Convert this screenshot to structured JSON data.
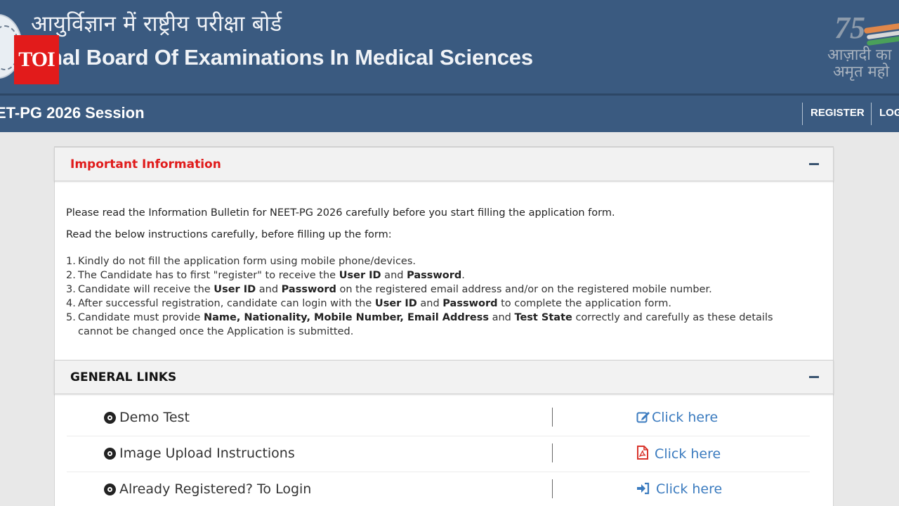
{
  "header": {
    "hindi_title": "आयुर्विज्ञान में राष्ट्रीय परीक्षा बोर्ड",
    "english_title": "ional Board Of Examinations In Medical Sciences",
    "toi_badge": "TOI",
    "azadi_logo": {
      "number": "75",
      "line1": "आज़ादी का",
      "line2": "अमृत महो"
    }
  },
  "navbar": {
    "session_title": "ET-PG 2026 Session",
    "links": [
      "REGISTER",
      "LOG"
    ]
  },
  "important_info": {
    "title": "Important Information",
    "title_color": "#e01b1b",
    "intro": "Please read the Information Bulletin for NEET-PG 2026 carefully before you start filling the application form.",
    "subheading": "Read the below instructions carefully, before filling up the form:",
    "instructions": [
      {
        "num": "1.",
        "parts": [
          "Kindly do not fill the application form using mobile phone/devices."
        ]
      },
      {
        "num": "2.",
        "parts": [
          "The Candidate has to first \"register\" to receive the ",
          "User ID",
          " and ",
          "Password",
          "."
        ]
      },
      {
        "num": "3.",
        "parts": [
          "Candidate will receive the ",
          "User ID",
          " and ",
          "Password",
          " on the registered email address and/or on the registered mobile number."
        ]
      },
      {
        "num": "4.",
        "parts": [
          "After successful registration, candidate can login with the ",
          "User ID",
          " and ",
          "Password",
          " to complete the application form."
        ]
      },
      {
        "num": "5.",
        "parts": [
          "Candidate must provide ",
          "Name, Nationality, Mobile Number, Email Address",
          " and ",
          "Test State",
          " correctly and carefully as these details cannot be changed once the Application is submitted."
        ]
      }
    ]
  },
  "general_links": {
    "title": "GENERAL LINKS",
    "rows": [
      {
        "label": "Demo Test",
        "action": "Click here",
        "icon": "edit-icon"
      },
      {
        "label": "Image Upload Instructions",
        "action": "Click here",
        "icon": "pdf-icon"
      },
      {
        "label": "Already Registered? To Login",
        "action": "Click here",
        "icon": "sign-in-icon"
      }
    ]
  },
  "colors": {
    "banner": "#3a5a80",
    "link": "#3b7bbf",
    "pdf_icon": "#d9342b"
  }
}
